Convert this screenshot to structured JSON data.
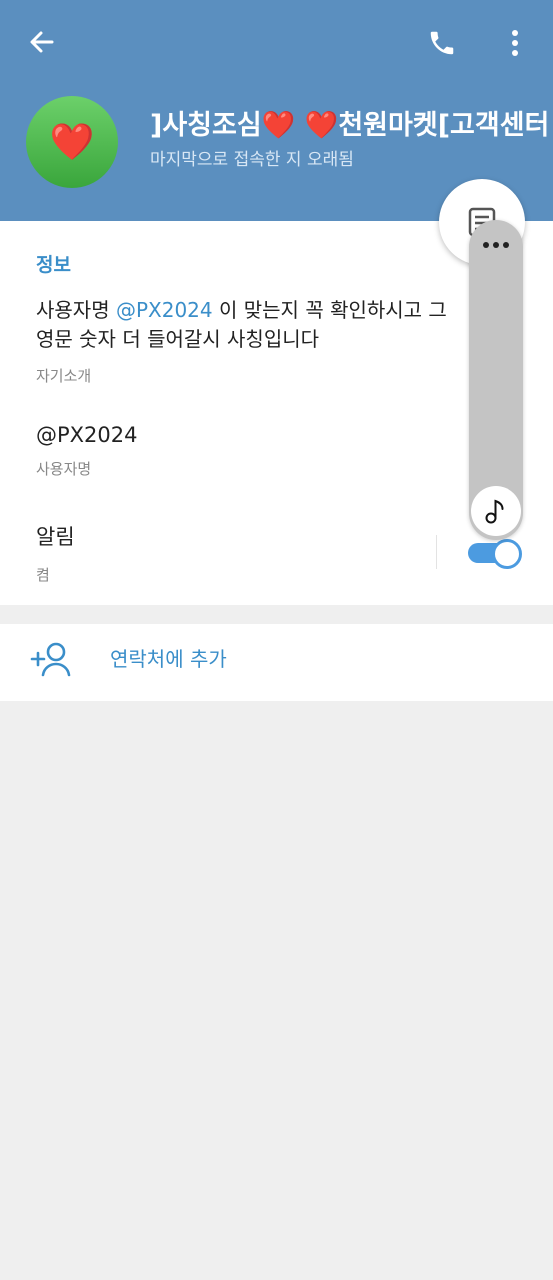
{
  "header": {
    "contact_name": "]사칭조심❤️   ❤️천원마켓[고객센터",
    "status": "마지막으로 접속한 지 오래됨",
    "avatar_emoji": "❤️",
    "colors": {
      "header_bg": "#5b8fbf",
      "accent": "#3a8ec9"
    },
    "icons": [
      "back-arrow-icon",
      "phone-icon",
      "more-vert-icon"
    ]
  },
  "info": {
    "section_title": "정보",
    "bio_prefix": "사용자명 ",
    "bio_mention": "@PX2024",
    "bio_rest_line1": " 이 맞는지 꼭 확인하시고 그",
    "bio_line2": "영문 숫자 더 들어갈시 사칭입니다",
    "bio_caption": "자기소개",
    "username": "@PX2024",
    "username_caption": "사용자명",
    "notifications_label": "알림",
    "notifications_value": "켬",
    "notifications_on": true
  },
  "actions": {
    "add_contact_label": "연락처에 추가"
  }
}
